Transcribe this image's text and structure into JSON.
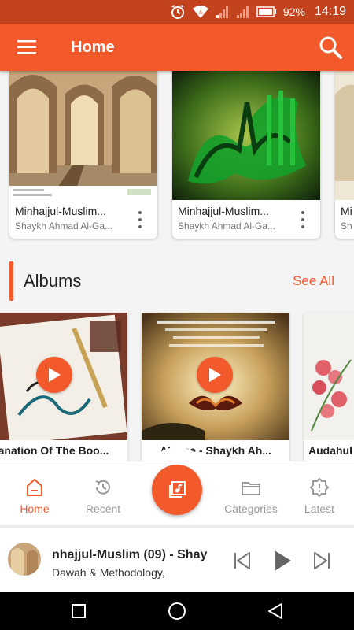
{
  "status_bar": {
    "battery": "92%",
    "time": "14:19"
  },
  "app_bar": {
    "title": "Home",
    "menu_icon": "hamburger-menu-icon",
    "search_icon": "search-icon"
  },
  "tracks": [
    {
      "title": "Minhajjul-Muslim...",
      "subtitle": "Shaykh Ahmad Al-Ga...",
      "thumb": "mosque-arches"
    },
    {
      "title": "Minhajjul-Muslim...",
      "subtitle": "Shaykh Ahmad Al-Ga...",
      "thumb": "green-calligraphy"
    },
    {
      "title": "Mi",
      "subtitle": "Sh",
      "thumb": "light-arches"
    }
  ],
  "albums_section": {
    "title": "Albums",
    "see_all": "See All"
  },
  "albums": [
    {
      "title": "anation Of The Boo...",
      "thumb": "calligraphy-pen"
    },
    {
      "title": "Al-...ee - Shaykh Ah...",
      "thumb": "butterfly-quote"
    },
    {
      "title": "Audahul",
      "thumb": "pink-flowers"
    }
  ],
  "bottom_nav": {
    "items": [
      {
        "label": "Home",
        "active": true,
        "icon": "home-icon"
      },
      {
        "label": "Recent",
        "active": false,
        "icon": "history-icon"
      },
      {
        "label": "Categories",
        "active": false,
        "icon": "folder-icon"
      },
      {
        "label": "Latest",
        "active": false,
        "icon": "latest-gear-icon"
      }
    ],
    "center_icon": "library-music-icon"
  },
  "player": {
    "title": "nhajjul-Muslim (09) - Shay",
    "subtitle": "Dawah & Methodology,",
    "prev_icon": "skip-previous-icon",
    "play_icon": "play-icon",
    "next_icon": "skip-next-icon"
  },
  "colors": {
    "accent": "#f25a2c",
    "status_bar": "#c2431e",
    "background": "#f4f4f4"
  }
}
